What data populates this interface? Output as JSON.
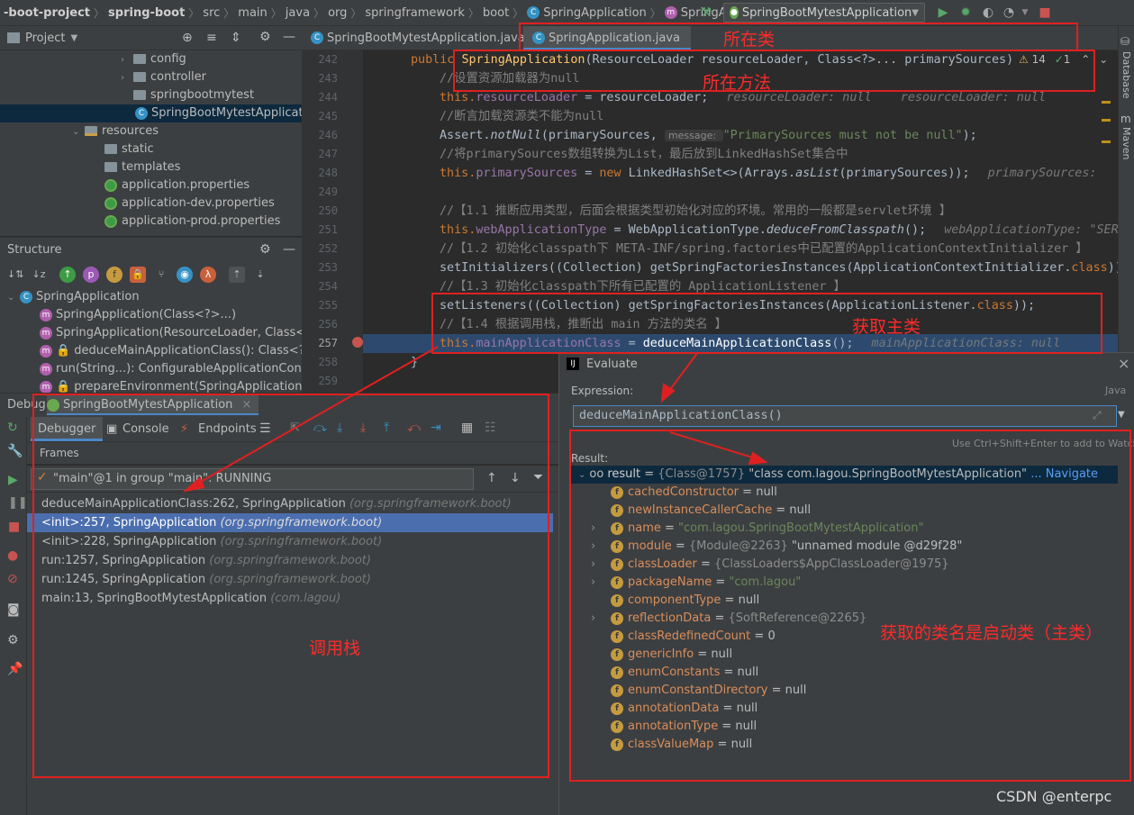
{
  "breadcrumbs": [
    "-boot-project",
    "spring-boot",
    "src",
    "main",
    "java",
    "org",
    "springframework",
    "boot",
    "SpringApplication",
    "SpringApplication"
  ],
  "run_config": "SpringBootMytestApplication",
  "project_panel": {
    "title": "Project",
    "tree": [
      {
        "label": "config",
        "type": "folder"
      },
      {
        "label": "controller",
        "type": "folder"
      },
      {
        "label": "springbootmytest",
        "type": "folder"
      },
      {
        "label": "SpringBootMytestApplication",
        "type": "class"
      },
      {
        "label": "resources",
        "type": "folder"
      },
      {
        "label": "static",
        "type": "folder"
      },
      {
        "label": "templates",
        "type": "folder"
      },
      {
        "label": "application.properties",
        "type": "file"
      },
      {
        "label": "application-dev.properties",
        "type": "file"
      },
      {
        "label": "application-prod.properties",
        "type": "file"
      }
    ]
  },
  "structure_panel": {
    "title": "Structure",
    "items": [
      {
        "label": "SpringApplication",
        "type": "class"
      },
      {
        "label": "SpringApplication(Class<?>...)",
        "type": "method"
      },
      {
        "label": "SpringApplication(ResourceLoader, Class<?>...)",
        "type": "method"
      },
      {
        "label": "deduceMainApplicationClass(): Class<?>",
        "type": "method-locked"
      },
      {
        "label": "run(String...): ConfigurableApplicationContext",
        "type": "method"
      },
      {
        "label": "prepareEnvironment(SpringApplicationRunListeners...)",
        "type": "method-locked"
      }
    ]
  },
  "editor": {
    "tabs": [
      "SpringBootMytestApplication.java",
      "SpringApplication.java"
    ],
    "inspection": {
      "warnings": "14",
      "ok": "1"
    },
    "line_numbers": [
      "242",
      "243",
      "244",
      "245",
      "246",
      "247",
      "248",
      "249",
      "250",
      "251",
      "252",
      "253",
      "254",
      "255",
      "256",
      "257",
      "258",
      "259"
    ],
    "lines": {
      "l242a": "public ",
      "l242b": "SpringApplication",
      "l242c": "(ResourceLoader resourceLoader, Class<?>... primarySources)",
      "l243": "//设置资源加载器为null",
      "l244a": "this.",
      "l244b": "resourceLoader",
      "l244c": " = resourceLoader;",
      "l244h": "resourceLoader: null    resourceLoader: null",
      "l245": "//断言加载资源类不能为null",
      "l246a": "Assert.",
      "l246b": "notNull",
      "l246c": "(primarySources, ",
      "l246d": "message: ",
      "l246e": "\"PrimarySources must not be null\"",
      "l246f": ");",
      "l247": "//将primarySources数组转换为List，最后放到LinkedHashSet集合中",
      "l248a": "this.",
      "l248b": "primarySources",
      "l248c": " = ",
      "l248d": "new ",
      "l248e": "LinkedHashSet<>(Arrays.",
      "l248f": "asList",
      "l248g": "(primarySources));",
      "l248h": "primarySources: ",
      "l250": "//【1.1 推断应用类型，后面会根据类型初始化对应的环境。常用的一般都是servlet环境 】",
      "l251a": "this.",
      "l251b": "webApplicationType",
      "l251c": " = WebApplicationType.",
      "l251d": "deduceFromClasspath",
      "l251e": "();",
      "l251h": "webApplicationType: \"SER",
      "l252": "//【1.2 初始化classpath下 META-INF/spring.factories中已配置的ApplicationContextInitializer 】",
      "l253a": "setInitializers((Collection) getSpringFactoriesInstances(ApplicationContextInitializer.",
      "l253b": "class",
      "l253c": "));",
      "l254": "//【1.3 初始化classpath下所有已配置的 ApplicationListener 】",
      "l255a": "setListeners((Collection) getSpringFactoriesInstances(ApplicationListener.",
      "l255b": "class",
      "l255c": "));",
      "l256": "//【1.4 根据调用栈，推断出 main 方法的类名 】",
      "l257a": "this.",
      "l257b": "mainApplicationClass",
      "l257c": " = ",
      "l257d": "deduceMainApplicationClass",
      "l257e": "();",
      "l257h": "mainApplicationClass: null",
      "l258": "}"
    }
  },
  "right_tools": [
    "Database",
    "Maven"
  ],
  "debug": {
    "title": "Debug:",
    "session": "SpringBootMytestApplication",
    "tabs": [
      "Debugger",
      "Console",
      "Endpoints"
    ],
    "frames_label": "Frames",
    "thread": "\"main\"@1 in group \"main\": RUNNING",
    "frames": [
      {
        "method": "deduceMainApplicationClass:262, SpringApplication",
        "pkg": "(org.springframework.boot)"
      },
      {
        "method": "<init>:257, SpringApplication",
        "pkg": "(org.springframework.boot)"
      },
      {
        "method": "<init>:228, SpringApplication",
        "pkg": "(org.springframework.boot)"
      },
      {
        "method": "run:1257, SpringApplication",
        "pkg": "(org.springframework.boot)"
      },
      {
        "method": "run:1245, SpringApplication",
        "pkg": "(org.springframework.boot)"
      },
      {
        "method": "main:13, SpringBootMytestApplication",
        "pkg": "(com.lagou)"
      }
    ]
  },
  "evaluate": {
    "title": "Evaluate",
    "expression_label": "Expression:",
    "language": "Java",
    "expression": "deduceMainApplicationClass()",
    "hint": "Use Ctrl+Shift+Enter to add to Watche",
    "result_label": "Result:",
    "result": {
      "name": "result",
      "ref": "{Class@1757}",
      "value": "\"class com.lagou.SpringBootMytestApplication\"",
      "navigate": "... Navigate"
    },
    "fields": [
      {
        "name": "cachedConstructor",
        "value": "null",
        "kind": "plain",
        "expand": false
      },
      {
        "name": "newInstanceCallerCache",
        "value": "null",
        "kind": "plain",
        "expand": false
      },
      {
        "name": "name",
        "value": "\"com.lagou.SpringBootMytestApplication\"",
        "kind": "str",
        "expand": true
      },
      {
        "name": "module",
        "ref": "{Module@2263}",
        "value": "\"unnamed module @d29f28\"",
        "kind": "obj",
        "expand": true
      },
      {
        "name": "classLoader",
        "ref": "{ClassLoaders$AppClassLoader@1975}",
        "value": "",
        "kind": "obj",
        "expand": true
      },
      {
        "name": "packageName",
        "value": "\"com.lagou\"",
        "kind": "str",
        "expand": true
      },
      {
        "name": "componentType",
        "value": "null",
        "kind": "plain",
        "expand": false
      },
      {
        "name": "reflectionData",
        "ref": "{SoftReference@2265}",
        "value": "",
        "kind": "obj",
        "expand": true
      },
      {
        "name": "classRedefinedCount",
        "value": "0",
        "kind": "plain",
        "expand": false
      },
      {
        "name": "genericInfo",
        "value": "null",
        "kind": "plain",
        "expand": false
      },
      {
        "name": "enumConstants",
        "value": "null",
        "kind": "plain",
        "expand": false
      },
      {
        "name": "enumConstantDirectory",
        "value": "null",
        "kind": "plain",
        "expand": false
      },
      {
        "name": "annotationData",
        "value": "null",
        "kind": "plain",
        "expand": false
      },
      {
        "name": "annotationType",
        "value": "null",
        "kind": "plain",
        "expand": false
      },
      {
        "name": "classValueMap",
        "value": "null",
        "kind": "plain",
        "expand": false
      }
    ]
  },
  "annotations": {
    "class_label": "所在类",
    "method_label": "所在方法",
    "main_class_label": "获取主类",
    "stack_label": "调用栈",
    "result_label": "获取的类名是启动类（主类）"
  },
  "watermark": "CSDN @enterpc",
  "colors": {
    "annotation": "#e02020",
    "selection": "#4b6eaf",
    "accent": "#4a88c7"
  }
}
